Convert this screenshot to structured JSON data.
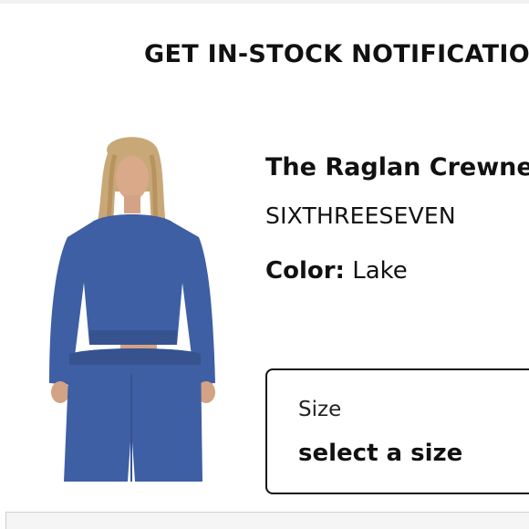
{
  "modal": {
    "title": "GET IN-STOCK NOTIFICATION"
  },
  "product": {
    "name": "The Raglan Crewneck",
    "brand": "SIXTHREESEVEN",
    "color_label": "Color:",
    "color_value": "Lake",
    "image_alt": "model wearing blue cropped crewneck sweatshirt and sweatpants"
  },
  "size_select": {
    "label": "Size",
    "value": "select a size"
  },
  "colors": {
    "garment": "#3f5fa4",
    "text": "#111111",
    "border": "#111111"
  }
}
